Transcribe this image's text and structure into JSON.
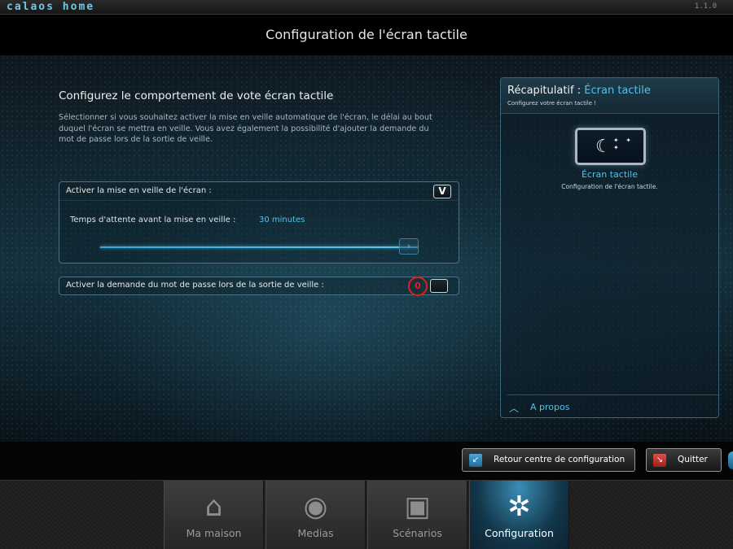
{
  "app": {
    "brand": "calaos home",
    "version": "1.1.0"
  },
  "header": {
    "title": "Configuration de l'écran tactile"
  },
  "section": {
    "title": "Configurez le comportement de vote écran tactile",
    "description": "Sélectionner si vous souhaitez activer la mise en veille automatique de l'écran, le délai au bout duquel l'écran se mettra en veille. Vous avez également la possibilité d'ajouter la demande du mot de passe lors de la sortie de veille."
  },
  "sleep": {
    "label": "Activer la mise en veille de l'écran :",
    "checked_mark": "V",
    "checked": true,
    "delay_label": "Temps d'attente avant la mise en veille :",
    "delay_value": "30 minutes",
    "slider_fraction": 1.0
  },
  "password": {
    "label": "Activer la demande du mot de passe lors de la sortie de veille :",
    "checked": false,
    "marker": "0"
  },
  "summary": {
    "title_prefix": "Récapitulatif : ",
    "title_accent": "Écran tactile",
    "subtitle": "Configurez votre écran tactile !",
    "item_name": "Écran tactile",
    "item_desc": "Configuration de l'écran tactile.",
    "about": "A propos",
    "icon": "night-screen-icon"
  },
  "actions": {
    "back": "Retour centre de configuration",
    "quit": "Quitter"
  },
  "nav": {
    "tabs": [
      {
        "label": "Ma maison",
        "icon": "house-icon"
      },
      {
        "label": "Medias",
        "icon": "disc-icon"
      },
      {
        "label": "Scénarios",
        "icon": "scenario-icon"
      },
      {
        "label": "Configuration",
        "icon": "config-icon",
        "active": true
      }
    ]
  },
  "colors": {
    "accent": "#55c2ea",
    "marker": "#e0201a"
  }
}
